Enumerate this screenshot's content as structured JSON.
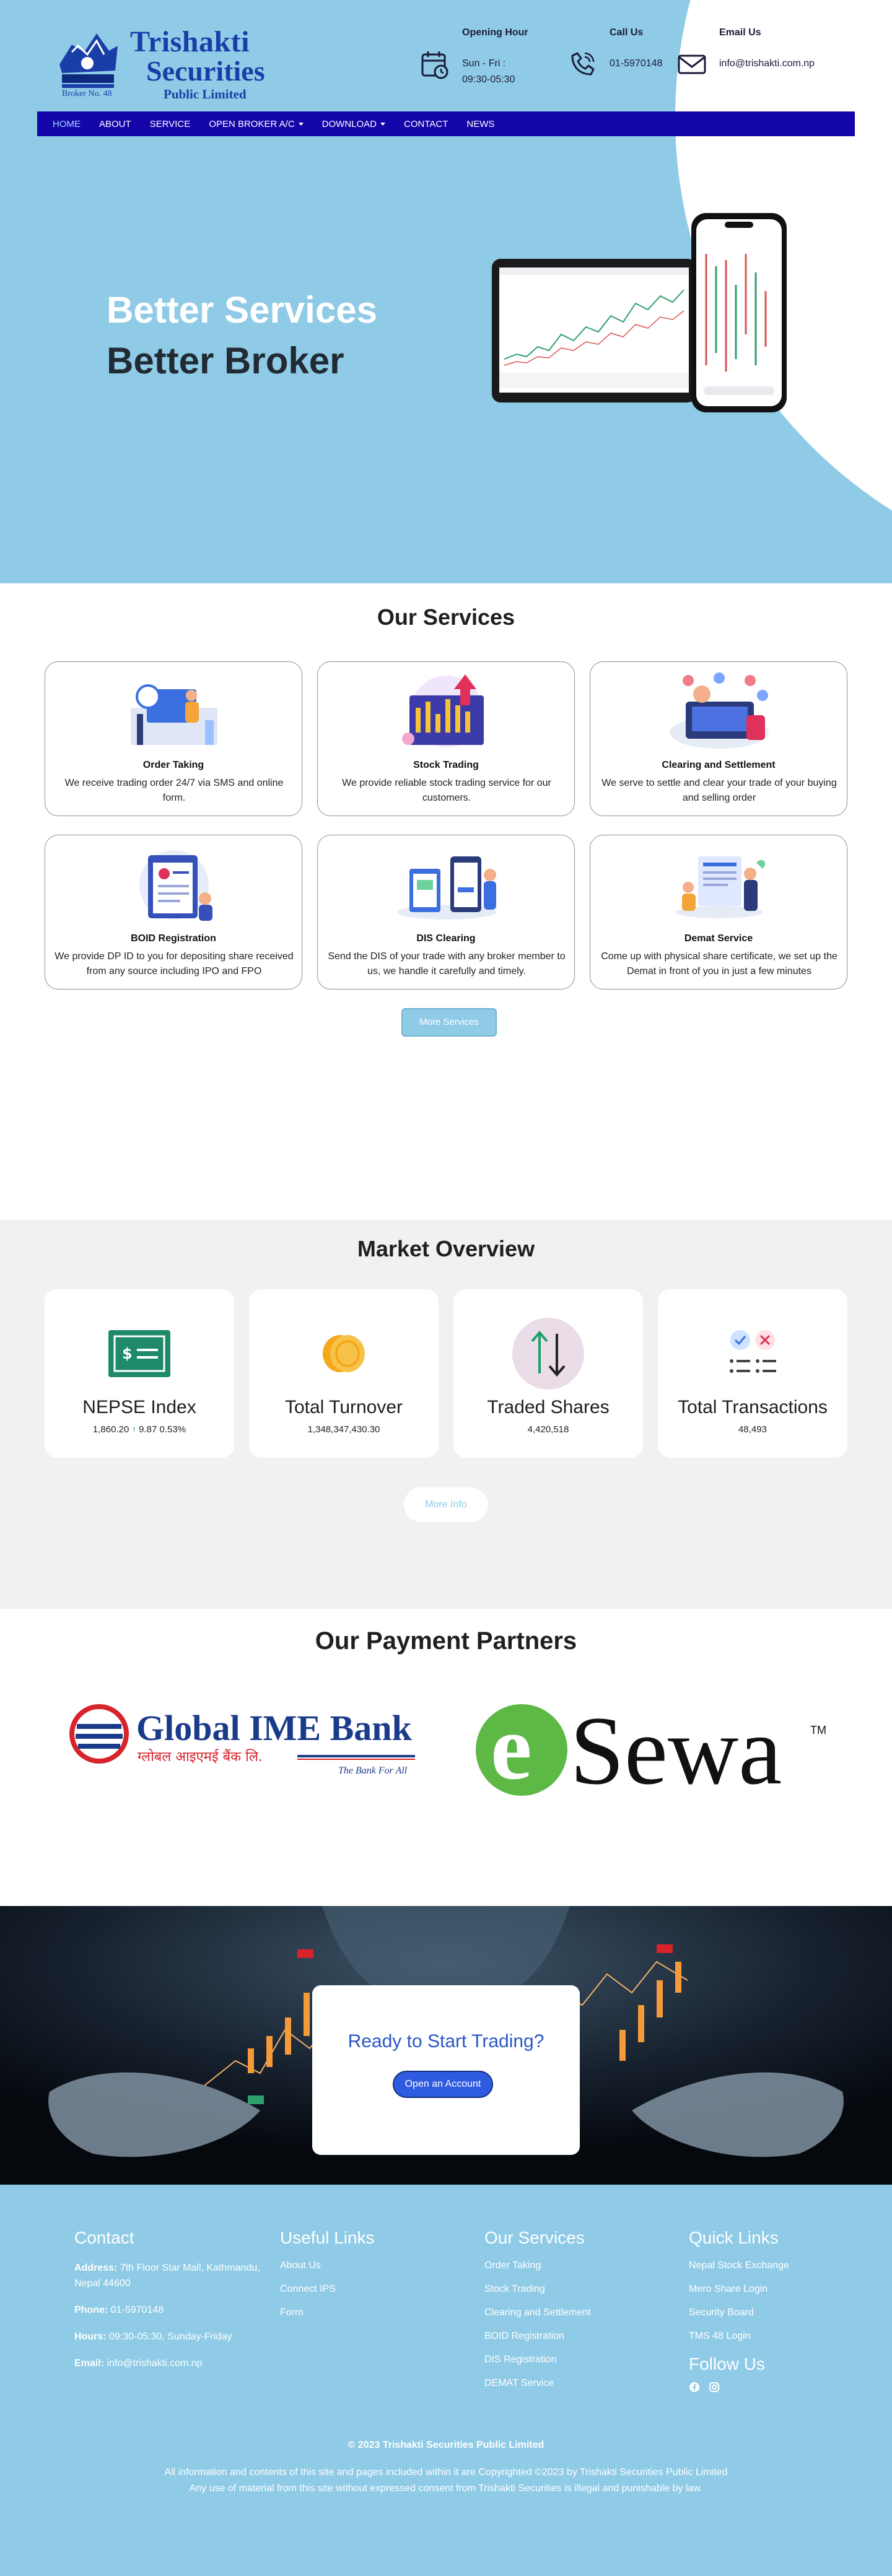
{
  "brand": {
    "name_line1": "Trishakti",
    "name_line2": "Securities",
    "name_line3": "Public Limited",
    "broker_no": "Broker No. 48",
    "emblem_text": "TRISHAKTI SECURITIES",
    "color": "#1a3ea8"
  },
  "contact": {
    "hours_title": "Opening Hour",
    "hours_value": "Sun - Fri : 09:30-05:30",
    "call_title": "Call Us",
    "call_value": "01-5970148",
    "email_title": "Email Us",
    "email_value": "info@trishakti.com.np"
  },
  "nav": {
    "items": [
      {
        "label": "HOME",
        "active": true
      },
      {
        "label": "ABOUT"
      },
      {
        "label": "SERVICE"
      },
      {
        "label": "OPEN BROKER A/C",
        "dropdown": true
      },
      {
        "label": "DOWNLOAD",
        "dropdown": true
      },
      {
        "label": "CONTACT"
      },
      {
        "label": "NEWS"
      }
    ],
    "bg_color": "#1406a8"
  },
  "hero": {
    "line1": "Better Services",
    "line2": "Better Broker",
    "bg_color": "#8fcbe6"
  },
  "services": {
    "title": "Our Services",
    "cards": [
      {
        "title": "Order Taking",
        "desc": "We receive trading order 24/7 via SMS and online form."
      },
      {
        "title": "Stock Trading",
        "desc": "We provide reliable stock trading service for our customers."
      },
      {
        "title": "Clearing and Settlement",
        "desc": "We serve to settle and clear your trade of your buying and selling order"
      },
      {
        "title": "BOID Registration",
        "desc": "We provide DP ID to you for depositing share received from any source including IPO and FPO"
      },
      {
        "title": "DIS Clearing",
        "desc": "Send the DIS of your trade with any broker member to us, we handle it carefully and timely."
      },
      {
        "title": "Demat Service",
        "desc": "Come up with physical share certificate, we set up the Demat in front of you in just a few minutes"
      }
    ],
    "more_button": "More Services"
  },
  "market": {
    "title": "Market Overview",
    "cards": [
      {
        "label": "NEPSE Index",
        "value": "1,860.20",
        "change": "9.87 0.53%"
      },
      {
        "label": "Total Turnover",
        "value": "1,348,347,430.30"
      },
      {
        "label": "Traded Shares",
        "value": "4,420,518"
      },
      {
        "label": "Total Transactions",
        "value": "48,493"
      }
    ],
    "more_button": "More Info"
  },
  "partners": {
    "title": "Our Payment Partners",
    "global_ime": {
      "name": "Global IME Bank",
      "nepali": "ग्लोबल आइएमई बैंक लि.",
      "tagline": "The Bank For All"
    },
    "esewa": {
      "letter": "e",
      "name": "Sewa",
      "tm": "TM"
    }
  },
  "cta": {
    "title": "Ready to Start Trading?",
    "button": "Open an Account"
  },
  "footer": {
    "contact_title": "Contact",
    "address_label": "Address:",
    "address_value": "7th Floor Star Mall, Kathmandu, Nepal 44600",
    "phone_label": "Phone:",
    "phone_value": "01-5970148",
    "hours_label": "Hours:",
    "hours_value": "09:30-05:30, Sunday-Friday",
    "email_label": "Email:",
    "email_value": "info@trishakti.com.np",
    "useful_title": "Useful Links",
    "useful_links": [
      "About Us",
      "Connect IPS",
      "Form"
    ],
    "services_title": "Our Services",
    "service_links": [
      "Order Taking",
      "Stock Trading",
      "Clearing and Settlement",
      "BOID Registration",
      "DIS Registration",
      "DEMAT Service"
    ],
    "quick_title": "Quick Links",
    "quick_links": [
      "Nepal Stock Exchange",
      "Mero Share Login",
      "Security Board",
      "TMS 48 Login"
    ],
    "follow_title": "Follow Us",
    "social_icons": [
      "facebook-icon",
      "instagram-icon"
    ],
    "copyright": "© 2023 Trishakti Securities Public Limited",
    "rights_line1": "All information and contents of this site and pages included within it are Copyrighted ©2023 by Trishakti Securities Public Limited",
    "rights_line2": "Any use of material from this site without expressed consent from Trishakti Securities is illegal and punishable by law."
  }
}
